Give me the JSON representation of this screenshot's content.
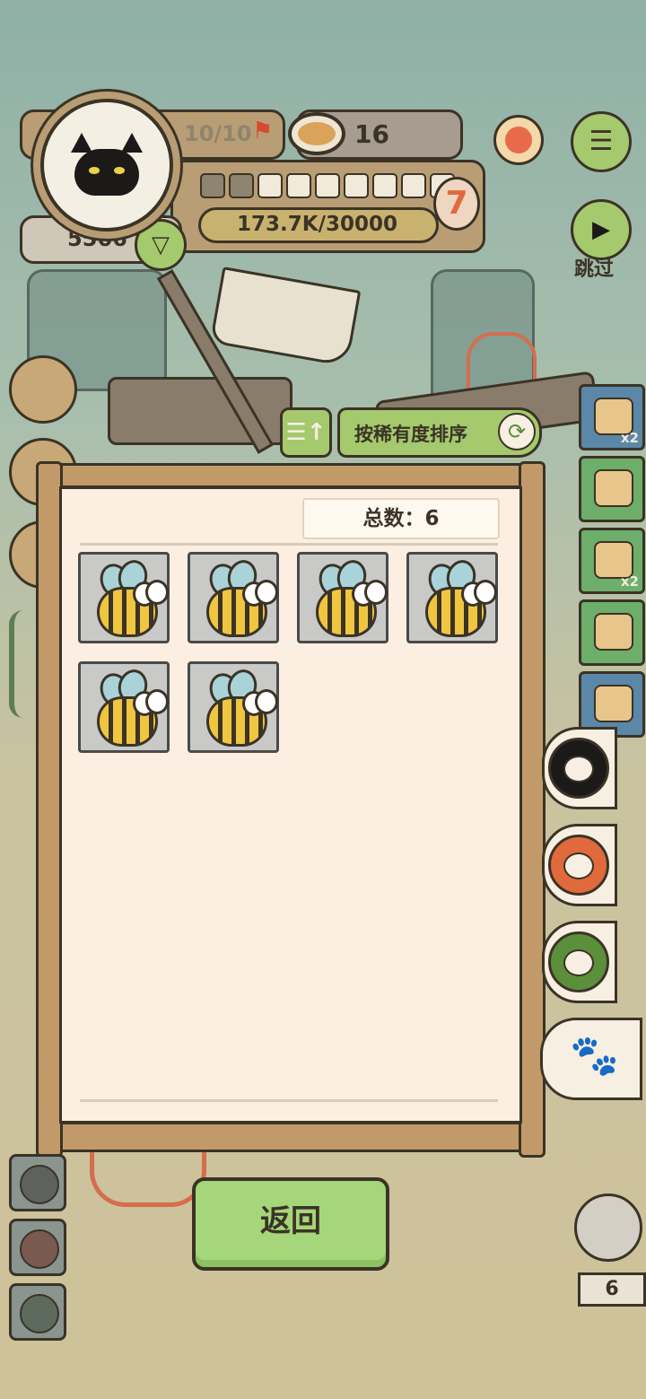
{
  "hud": {
    "flag_count": "10/10",
    "coin_count": "16",
    "gold": "5566",
    "progress_text": "173.7K/30000",
    "level": "7",
    "segments_total": 9,
    "segments_filled": 2
  },
  "controls": {
    "skip_label": "跳过"
  },
  "side_items": [
    {
      "icon": "bowl-icon",
      "badge": "x2"
    },
    {
      "icon": "ticket-x-icon",
      "badge": ""
    },
    {
      "icon": "ticket-refresh-icon",
      "badge": "x2"
    },
    {
      "icon": "pancake-stack-icon",
      "badge": ""
    },
    {
      "icon": "hut-icon",
      "badge": ""
    }
  ],
  "panel": {
    "sort_label": "按稀有度排序",
    "total_text": "总数：6",
    "items": [
      {
        "name": "bee"
      },
      {
        "name": "bee"
      },
      {
        "name": "bee"
      },
      {
        "name": "bee"
      },
      {
        "name": "bee"
      },
      {
        "name": "bee"
      }
    ]
  },
  "tabs": [
    "fish-icon",
    "bag-icon",
    "frog-icon",
    "paw-icon"
  ],
  "back_label": "返回",
  "corner_count": "6",
  "colors": {
    "accent_green": "#a5c96d",
    "frame_brown": "#c29a6a",
    "paper": "#fcefe2",
    "level_red": "#e06a3c"
  }
}
